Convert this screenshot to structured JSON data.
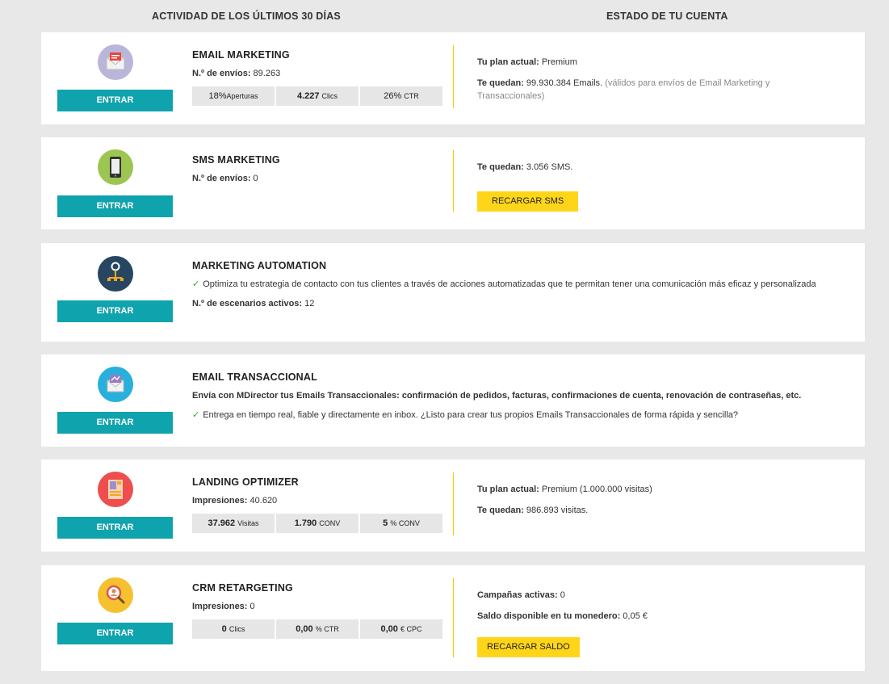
{
  "headers": {
    "left": "ACTIVIDAD DE LOS ÚLTIMOS 30 DÍAS",
    "right": "ESTADO DE TU CUENTA"
  },
  "enter_label": "ENTRAR",
  "email_marketing": {
    "title": "EMAIL MARKETING",
    "sends_label": "N.º de envíos:",
    "sends_value": "89.263",
    "stats": [
      {
        "value": "18%",
        "unit": "Aperturas"
      },
      {
        "value": "4.227",
        "unit": "Clics"
      },
      {
        "value": "26%",
        "unit": "CTR"
      }
    ],
    "plan_label": "Tu plan actual:",
    "plan_value": "Premium",
    "remaining_label": "Te quedan:",
    "remaining_value": "99.930.384 Emails.",
    "remaining_note": "(válidos para envíos de Email Marketing y Transaccionales)"
  },
  "sms_marketing": {
    "title": "SMS MARKETING",
    "sends_label": "N.º de envíos:",
    "sends_value": "0",
    "remaining_label": "Te quedan:",
    "remaining_value": "3.056 SMS.",
    "recharge_label": "RECARGAR SMS"
  },
  "marketing_automation": {
    "title": "MARKETING AUTOMATION",
    "check_text": "Optimiza tu estrategia de contacto con tus clientes a través de acciones automatizadas que te permitan tener una comunicación más eficaz y personalizada",
    "scenarios_label": "N.º de escenarios activos:",
    "scenarios_value": "12"
  },
  "email_transaccional": {
    "title": "EMAIL TRANSACCIONAL",
    "description": "Envía con MDirector tus Emails Transaccionales: confirmación de pedidos, facturas, confirmaciones de cuenta, renovación de contraseñas, etc.",
    "check_text": "Entrega en tiempo real, fiable y directamente en inbox. ¿Listo para crear tus propios Emails Transaccionales de forma rápida y sencilla?"
  },
  "landing_optimizer": {
    "title": "LANDING OPTIMIZER",
    "impressions_label": "Impresiones:",
    "impressions_value": "40.620",
    "stats": [
      {
        "value": "37.962",
        "unit": "Visitas"
      },
      {
        "value": "1.790",
        "unit": "CONV"
      },
      {
        "value": "5",
        "unit": "% CONV"
      }
    ],
    "plan_label": "Tu plan actual:",
    "plan_value": "Premium (1.000.000 visitas)",
    "remaining_label": "Te quedan:",
    "remaining_value": "986.893 visitas."
  },
  "crm_retargeting": {
    "title": "CRM RETARGETING",
    "impressions_label": "Impresiones:",
    "impressions_value": "0",
    "stats": [
      {
        "value": "0",
        "unit": "Clics"
      },
      {
        "value": "0,00",
        "unit": "% CTR"
      },
      {
        "value": "0,00",
        "unit": "€ CPC"
      }
    ],
    "campaigns_label": "Campañas activas:",
    "campaigns_value": "0",
    "wallet_label": "Saldo disponible en tu monedero:",
    "wallet_value": "0,05 €",
    "recharge_label": "RECARGAR SALDO"
  }
}
